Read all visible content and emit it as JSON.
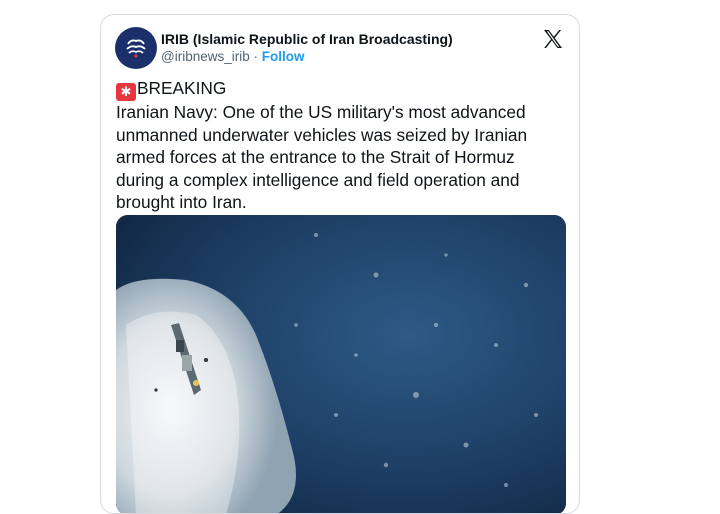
{
  "tweet": {
    "author_name": "IRIB (Islamic Republic of Iran Broadcasting)",
    "handle": "@iribnews_irib",
    "separator": "·",
    "follow_label": "Follow",
    "breaking_emoji": "siren-icon",
    "breaking_label": "BREAKING",
    "body": "Iranian Navy: One of the US military's most advanced unmanned underwater vehicles was seized by Iranian armed forces at the entrance to the Strait of Hormuz during a complex intelligence and field operation and brought into Iran.",
    "avatar_icon": "irib-logo-icon",
    "platform_icon": "x-logo-icon",
    "media_icon": "ship-at-sea-photo"
  },
  "colors": {
    "follow": "#1d9bf0",
    "text": "#0f1419",
    "secondary_text": "#536471",
    "avatar_bg": "#1b2f6b",
    "siren": "#e8363f"
  }
}
